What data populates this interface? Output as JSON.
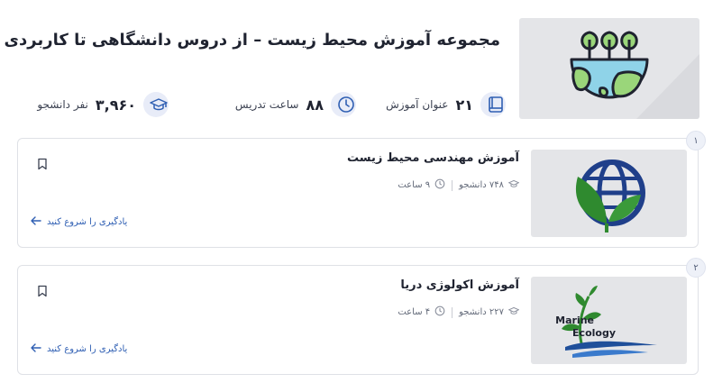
{
  "header": {
    "title": "مجموعه آموزش محیط زیست – از دروس دانشگاهی تا کاربردی",
    "image_icon": "environment-globe-trees-icon",
    "stats": [
      {
        "icon": "book-icon",
        "value": "۲۱",
        "label": "عنوان آموزش"
      },
      {
        "icon": "clock-icon",
        "value": "۸۸",
        "label": "ساعت تدریس"
      },
      {
        "icon": "graduation-cap-icon",
        "value": "۳,۹۶۰",
        "label": "نفر دانشجو"
      }
    ]
  },
  "courses": [
    {
      "index": "۱",
      "title": "آموزش مهندسی محیط زیست",
      "students": "۷۴۸ دانشجو",
      "hours": "۹ ساعت",
      "cta": "یادگیری را شروع کنید",
      "image_icon": "leaf-globe-icon"
    },
    {
      "index": "۲",
      "title": "آموزش اکولوژی دریا",
      "students": "۲۲۷ دانشجو",
      "hours": "۴ ساعت",
      "cta": "یادگیری را شروع کنید",
      "image_icon": "marine-ecology-logo",
      "image_text_1": "Marine",
      "image_text_2": "Ecology"
    }
  ],
  "colors": {
    "accent": "#2f5fb3",
    "icon_bg": "#e8ecf8",
    "text": "#1f2330",
    "card_border": "#dfe1e6"
  }
}
